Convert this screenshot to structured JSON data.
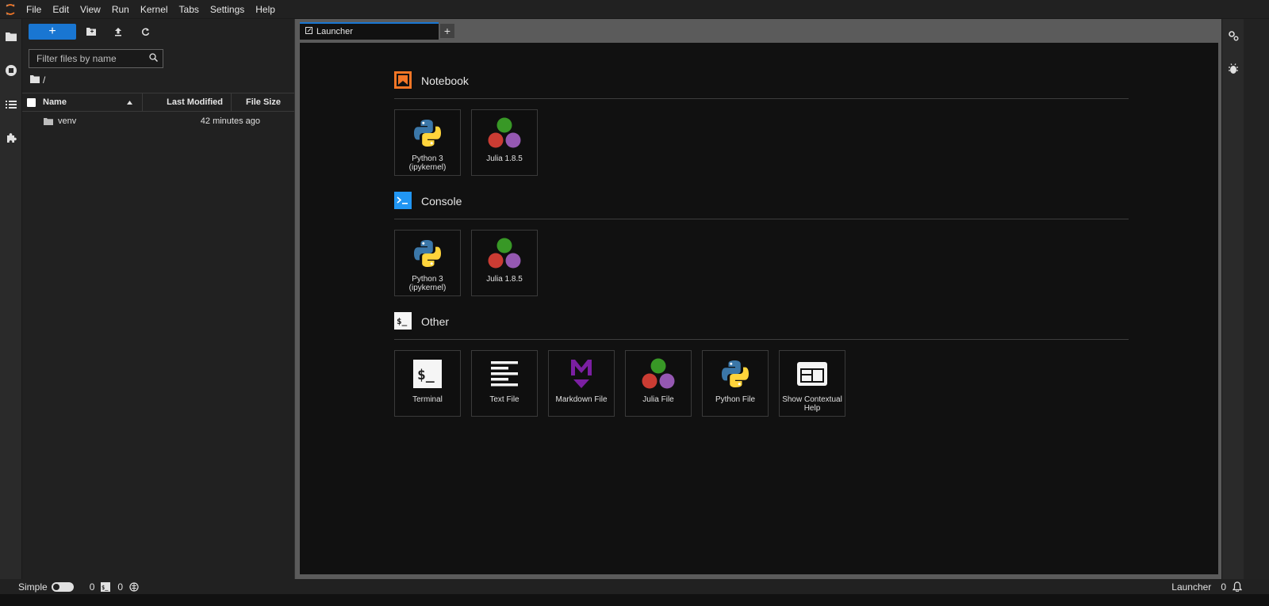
{
  "menubar": {
    "items": [
      "File",
      "Edit",
      "View",
      "Run",
      "Kernel",
      "Tabs",
      "Settings",
      "Help"
    ]
  },
  "file_browser": {
    "new_button_label": "+",
    "filter_placeholder": "Filter files by name",
    "breadcrumb_path": "/",
    "columns": {
      "name": "Name",
      "modified": "Last Modified",
      "size": "File Size"
    },
    "rows": [
      {
        "name": "venv",
        "modified": "42 minutes ago",
        "size": ""
      }
    ]
  },
  "tabs": {
    "active": "Launcher",
    "add_label": "+"
  },
  "launcher": {
    "notebook": {
      "title": "Notebook",
      "cards": [
        {
          "label_line1": "Python 3",
          "label_line2": "(ipykernel)"
        },
        {
          "label_line1": "Julia 1.8.5",
          "label_line2": ""
        }
      ]
    },
    "console": {
      "title": "Console",
      "cards": [
        {
          "label_line1": "Python 3",
          "label_line2": "(ipykernel)"
        },
        {
          "label_line1": "Julia 1.8.5",
          "label_line2": ""
        }
      ]
    },
    "other": {
      "title": "Other",
      "cards": [
        {
          "label_line1": "Terminal",
          "label_line2": ""
        },
        {
          "label_line1": "Text File",
          "label_line2": ""
        },
        {
          "label_line1": "Markdown File",
          "label_line2": ""
        },
        {
          "label_line1": "Julia File",
          "label_line2": ""
        },
        {
          "label_line1": "Python File",
          "label_line2": ""
        },
        {
          "label_line1": "Show Contextual",
          "label_line2": "Help"
        }
      ]
    }
  },
  "statusbar": {
    "mode_label": "Simple",
    "kernel_count": "0",
    "terminal_count": "0",
    "right_label": "Launcher",
    "notification_count": "0"
  },
  "colors": {
    "accent": "#1976d2",
    "notebook_icon": "#f37626",
    "console_icon": "#2196f3",
    "julia_green": "#389826",
    "julia_red": "#cb3c33",
    "julia_purple": "#9558b2",
    "python_blue": "#3b77a8",
    "python_yellow": "#ffd43b",
    "markdown_purple": "#7b1fa2"
  },
  "icons": {
    "left_bar": [
      "folder-icon",
      "running-icon",
      "toc-icon",
      "extension-icon"
    ],
    "right_bar": [
      "property-inspector-icon",
      "debugger-icon"
    ]
  }
}
